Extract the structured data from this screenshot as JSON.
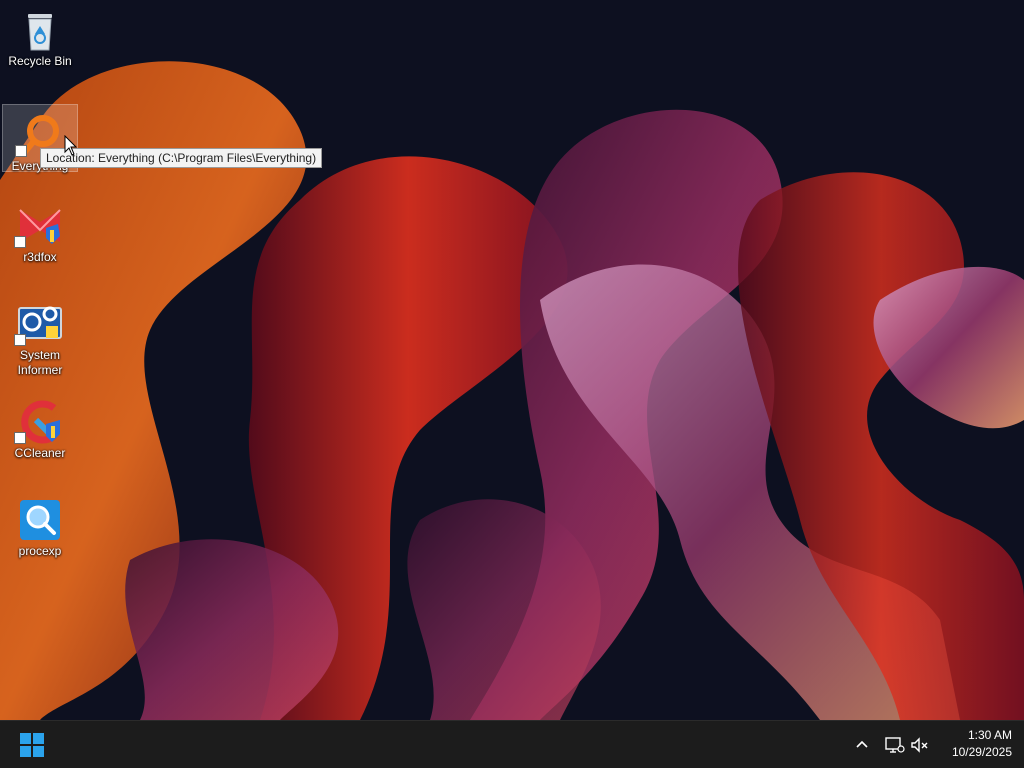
{
  "desktop": {
    "icons": [
      {
        "label": "Recycle Bin",
        "icon": "recycle-bin-icon"
      },
      {
        "label": "Everything",
        "icon": "everything-search-icon"
      },
      {
        "label": "r3dfox",
        "icon": "r3dfox-icon"
      },
      {
        "label": "System Informer",
        "icon": "system-informer-icon"
      },
      {
        "label": "CCleaner",
        "icon": "ccleaner-icon"
      },
      {
        "label": "procexp",
        "icon": "procexp-icon"
      }
    ],
    "tooltip": "Location: Everything (C:\\Program Files\\Everything)"
  },
  "taskbar": {
    "start_icon": "windows-start-icon",
    "tray": {
      "icons": [
        "chevron-up-icon",
        "network-icon",
        "volume-muted-icon"
      ],
      "time": "1:30 AM",
      "date": "10/29/2025"
    }
  },
  "colors": {
    "taskbar_bg": "#1c1c1c",
    "accent_blue": "#2ba3ec",
    "wallpaper_dark": "#0c0f1a"
  }
}
